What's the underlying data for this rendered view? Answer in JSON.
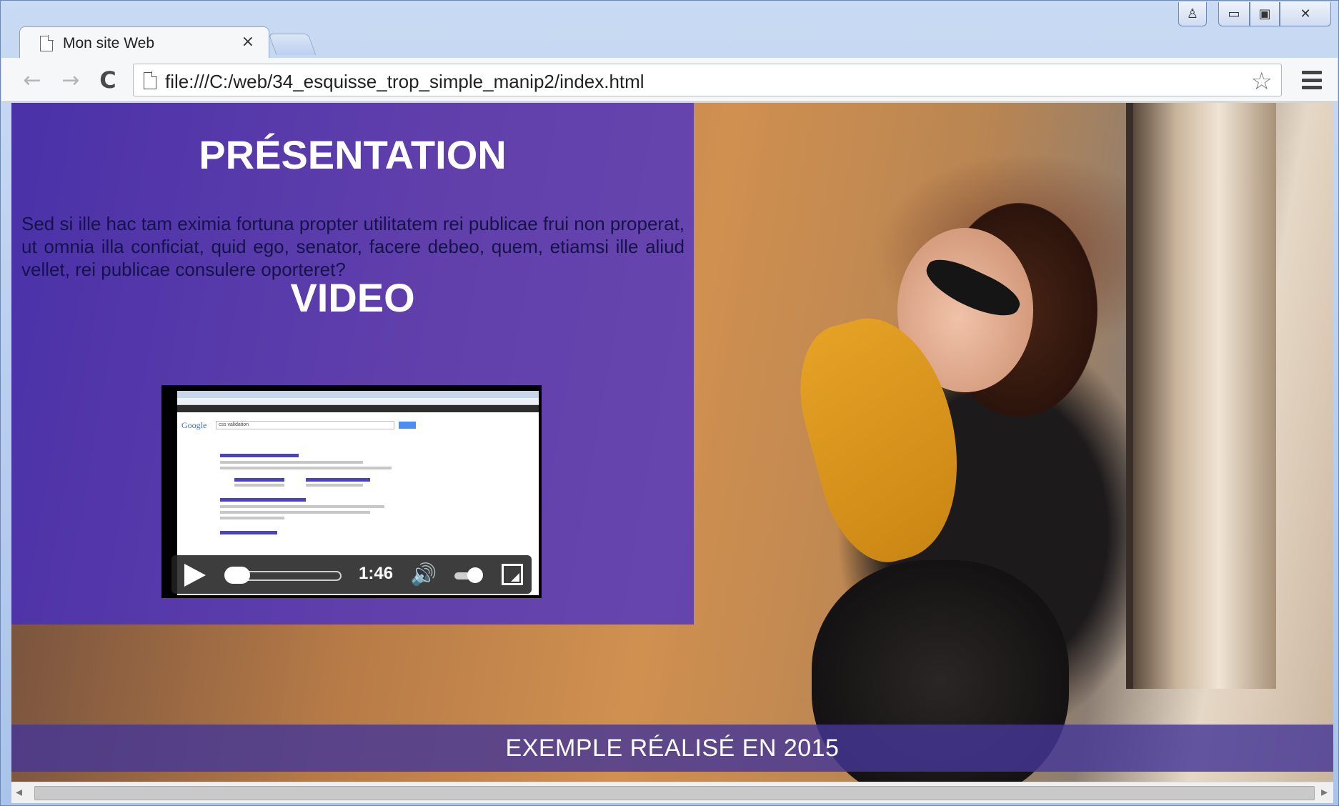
{
  "window": {
    "tab_title": "Mon site Web",
    "tab_close": "×",
    "controls": {
      "user_icon": "♙",
      "minimize_icon": "▭",
      "maximize_icon": "▣",
      "close_icon": "✕"
    }
  },
  "toolbar": {
    "back_icon": "←",
    "forward_icon": "→",
    "reload_icon": "C",
    "url": "file:///C:/web/34_esquisse_trop_simple_manip2/index.html",
    "star_icon": "☆"
  },
  "page": {
    "presentation_title": "PRÉSENTATION",
    "presentation_text": "Sed si ille hac tam eximia fortuna propter utilitatem rei publicae frui non properat, ut omnia illa conficiat, quid ego, senator, facere debeo, quem, etiamsi ille aliud vellet, rei publicae consulere oporteret?",
    "video_title": "VIDEO",
    "video": {
      "duration": "1:46",
      "thumbnail_logo": "Google",
      "thumbnail_query": "css validation"
    },
    "footer_text": "EXEMPLE RÉALISÉ EN 2015"
  },
  "scrollbar": {
    "left_arrow": "◂",
    "right_arrow": "▸"
  },
  "colors": {
    "panel_overlay": "#3e28d2",
    "footer_overlay": "#463796",
    "window_frame": "#a9c3ea"
  }
}
